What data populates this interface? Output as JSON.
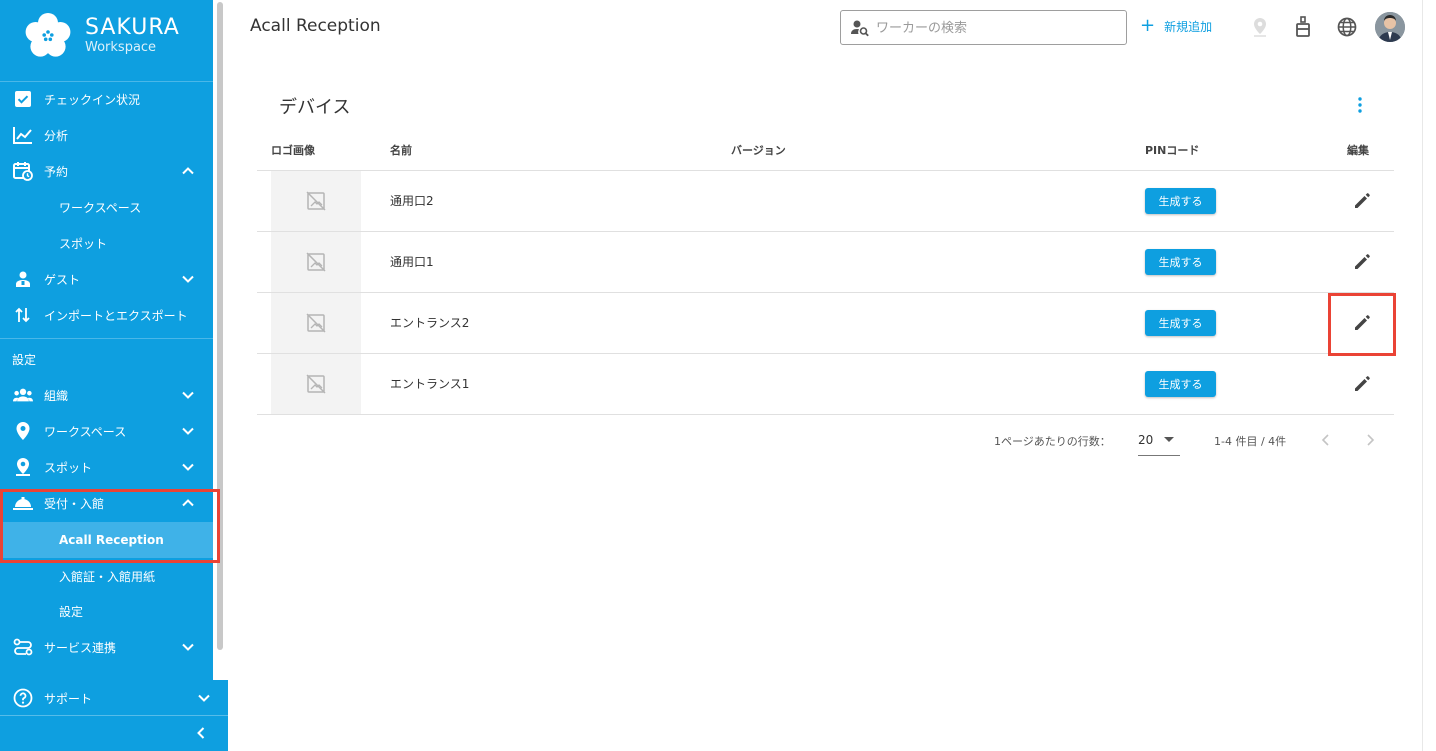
{
  "brand": {
    "name": "SAKURA",
    "sub": "Workspace"
  },
  "sidebar": {
    "items": [
      {
        "label": "チェックイン状況",
        "icon": "checkbox-icon"
      },
      {
        "label": "分析",
        "icon": "chart-line-icon"
      },
      {
        "label": "予約",
        "icon": "calendar-clock-icon",
        "expanded": true
      },
      {
        "label": "ワークスペース",
        "sub": true
      },
      {
        "label": "スポット",
        "sub": true
      },
      {
        "label": "ゲスト",
        "icon": "guest-icon",
        "expanded": false
      },
      {
        "label": "インポートとエクスポート",
        "icon": "import-export-icon"
      }
    ],
    "section_label": "設定",
    "settings_items": [
      {
        "label": "組織",
        "icon": "group-icon"
      },
      {
        "label": "ワークスペース",
        "icon": "location-pin-icon"
      },
      {
        "label": "スポット",
        "icon": "spot-pin-icon"
      },
      {
        "label": "受付・入館",
        "icon": "bell-reception-icon",
        "expanded": true
      },
      {
        "label": "Acall Reception",
        "sub": true,
        "active": true
      },
      {
        "label": "入館証・入館用紙",
        "sub": true
      },
      {
        "label": "設定",
        "sub": true
      },
      {
        "label": "サービス連携",
        "icon": "integration-icon"
      }
    ],
    "support": "サポート",
    "collapse": "collapse-left-icon"
  },
  "header": {
    "title": "Acall Reception",
    "search_placeholder": "ワーカーの検索",
    "add_label": "新規追加"
  },
  "main": {
    "section_title": "デバイス",
    "columns": [
      "ロゴ画像",
      "名前",
      "バージョン",
      "PINコード",
      "編集"
    ],
    "rows": [
      {
        "name": "通用口2",
        "version": "",
        "pin_button": "生成する"
      },
      {
        "name": "通用口1",
        "version": "",
        "pin_button": "生成する"
      },
      {
        "name": "エントランス2",
        "version": "",
        "pin_button": "生成する"
      },
      {
        "name": "エントランス1",
        "version": "",
        "pin_button": "生成する"
      }
    ],
    "pagination": {
      "rows_per_page_label": "1ページあたりの行数：",
      "rows_per_page": "20",
      "range": "1-4 件目 / 4件"
    }
  },
  "colors": {
    "accent": "#0e9fe0",
    "highlight": "#ea4335"
  }
}
